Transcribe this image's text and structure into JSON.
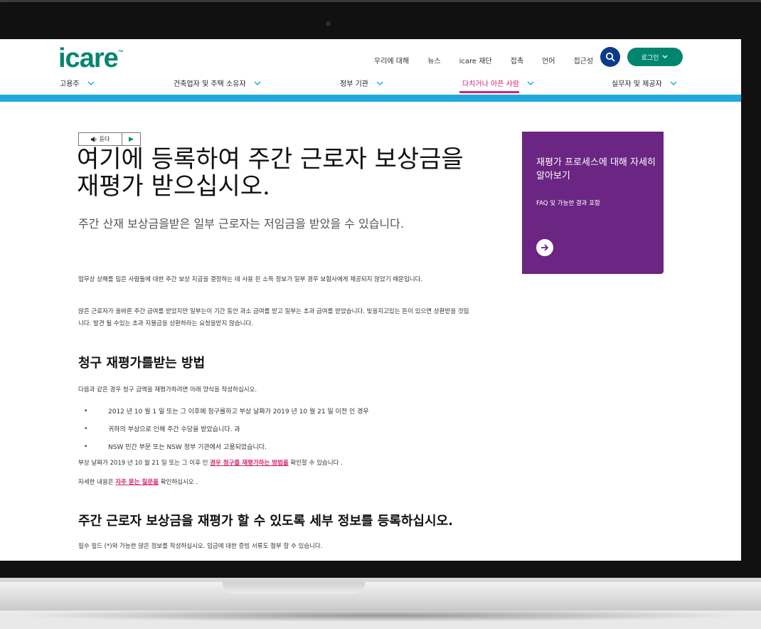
{
  "header": {
    "logo": "icare",
    "logo_tm": "™",
    "utility_links": [
      "우리에 대해",
      "뉴스",
      "icare 재단",
      "접촉",
      "언어",
      "접근성"
    ],
    "login_label": "로그인"
  },
  "nav": {
    "items": [
      "고용주",
      "건축업자 및 주택 소유자",
      "정부 기관",
      "다치거나 아픈 사람",
      "실무자 및 제공자"
    ],
    "active_index": 3
  },
  "listen": {
    "label": "듣다",
    "play": "▶"
  },
  "main": {
    "title": "여기에 등록하여 주간 근로자 보상금을 재평가 받으십시오.",
    "subtitle": "주간 산재 보상금을받은 일부 근로자는 저임금을 받았을 수 있습니다.",
    "para1": "업무상 상해를 입은 사람들에 대한 주간 보상 지급을 결정하는 데 사용 된 소득 정보가 일부 경우 보험사에게 제공되지 않았기 때문입니다.",
    "para2": "많은 근로자가 올바른 주간 급여를 받았지만 일부는이 기간 동안 과소 급여를 받고 일부는 초과 급여를 받았습니다. 빚을지고있는 돈이 있으면 상환받을 것입니다. 발견 될 수있는 초과 지불금을 상환하라는 요청을받지 않습니다.",
    "h2_claims": "청구 재평가를받는 방법",
    "claims_intro": "다음과 같은 경우 청구 금액을 재평가하려면 아래 양식을 작성하십시오.",
    "bullets": [
      "2012 년 10 월 1 일 또는 그 이후에 청구를하고 부상 날짜가 2019 년 10 월 21 일 이전 인 경우",
      "귀하의 부상으로 인해 주간 수당을 받았습니다. 과",
      "NSW 민간 부문 또는 NSW 정부 기관에서 고용되었습니다."
    ],
    "after_prefix": "부상 날짜가 2019 년 10 월 21 일 또는 그 이후 인 ",
    "after_link": "경우 청구를 재평가하는 방법을",
    "after_suffix": " 확인할 수 있습니다 .",
    "faq_prefix": "자세한 내용은 ",
    "faq_link": "자주 묻는 질문을",
    "faq_suffix": " 확인하십시오 .",
    "h2_register": "주간 근로자 보상금을 재평가 할 수 있도록 세부 정보를 등록하십시오.",
    "required_note": "필수 필드 (*)와 가능한 많은 정보를 작성하십시오. 임금에 대한 증빙 서류도 첨부 할 수 있습니다."
  },
  "card": {
    "title": "재평가 프로세스에 대해 자세히 알아보기",
    "subtitle": "FAQ 및 가능한 결과 포함"
  },
  "colors": {
    "brand_green": "#00866f",
    "accent_pink": "#d6246e",
    "blue_bar": "#1fa9dd",
    "card_purple": "#6b2582",
    "search_blue": "#0a3a8a"
  }
}
